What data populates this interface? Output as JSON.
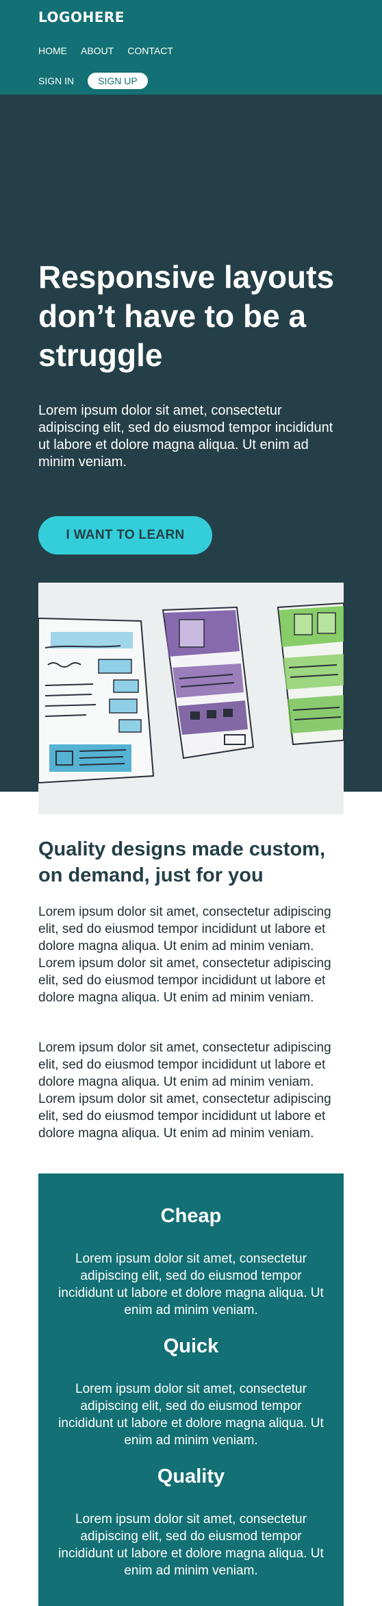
{
  "header": {
    "logo": "LOGOHERE",
    "nav": [
      "HOME",
      "ABOUT",
      "CONTACT"
    ],
    "sign_in": "SIGN IN",
    "sign_up": "SIGN UP"
  },
  "hero": {
    "title": "Responsive layouts don’t have to be a struggle",
    "text": "Lorem ipsum dolor sit amet, consectetur adipiscing elit, sed do eiusmod tempor incididunt ut labore et dolore magna aliqua. Ut enim ad minim veniam.",
    "button": "I WANT TO LEARN"
  },
  "content": {
    "title": "Quality designs made custom, on demand, just for you",
    "paragraphs": [
      "Lorem ipsum dolor sit amet, consectetur adipiscing elit, sed do eiusmod tempor incididunt ut labore et dolore magna aliqua. Ut enim ad minim veniam. Lorem ipsum dolor sit amet, consectetur adipiscing elit, sed do eiusmod tempor incididunt ut labore et dolore magna aliqua. Ut enim ad minim veniam.",
      "Lorem ipsum dolor sit amet, consectetur adipiscing elit, sed do eiusmod tempor incididunt ut labore et dolore magna aliqua. Ut enim ad minim veniam. Lorem ipsum dolor sit amet, consectetur adipiscing elit, sed do eiusmod tempor incididunt ut labore et dolore magna aliqua. Ut enim ad minim veniam."
    ]
  },
  "features": [
    {
      "title": "Cheap",
      "text": "Lorem ipsum dolor sit amet, consectetur adipiscing elit, sed do eiusmod tempor incididunt ut labore et dolore magna aliqua. Ut enim ad minim veniam."
    },
    {
      "title": "Quick",
      "text": "Lorem ipsum dolor sit amet, consectetur adipiscing elit, sed do eiusmod tempor incididunt ut labore et dolore magna aliqua. Ut enim ad minim veniam."
    },
    {
      "title": "Quality",
      "text": "Lorem ipsum dolor sit amet, consectetur adipiscing elit, sed do eiusmod tempor incididunt ut labore et dolore magna aliqua. Ut enim ad minim veniam."
    }
  ],
  "colors": {
    "header_bg": "#137074",
    "hero_bg": "#243f47",
    "accent": "#33ced9",
    "text_dark": "#1f2d33"
  }
}
